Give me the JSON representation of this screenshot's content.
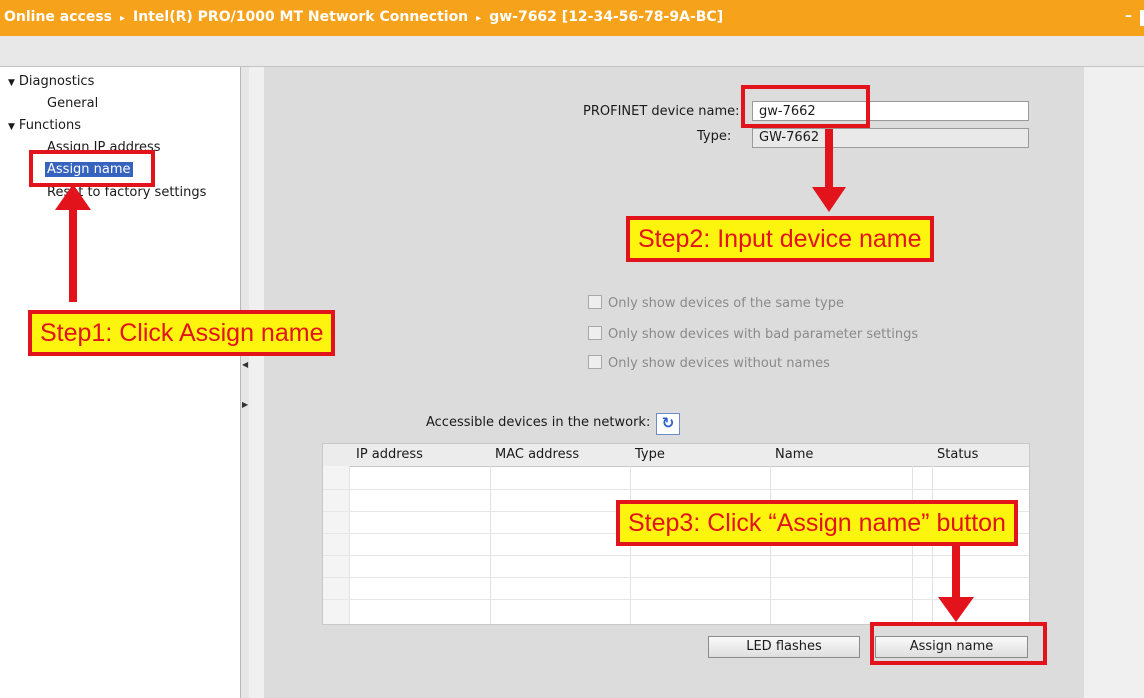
{
  "titlebar": {
    "crumb1": "Online access",
    "crumb2": "Intel(R) PRO/1000 MT Network Connection",
    "crumb3": "gw-7662 [12-34-56-78-9A-BC]",
    "separator": "▸",
    "minimize": "–"
  },
  "sidebar": {
    "diagnostics": "Diagnostics",
    "general": "General",
    "functions": "Functions",
    "assign_ip": "Assign IP address",
    "assign_name": "Assign name",
    "reset": "Reset to factory settings",
    "expanded_icon": "▼"
  },
  "form": {
    "device_name_label": "PROFINET device name:",
    "device_name_value": "gw-7662",
    "type_label": "Type:",
    "type_value": "GW-7662"
  },
  "filters": [
    {
      "label": "Only show devices of the same type",
      "checked": false
    },
    {
      "label": "Only show devices with bad parameter settings",
      "checked": false
    },
    {
      "label": "Only show devices without names",
      "checked": false
    }
  ],
  "network": {
    "label": "Accessible devices in the network:",
    "refresh_icon": "refresh-icon"
  },
  "table": {
    "columns": [
      "IP address",
      "MAC address",
      "Type",
      "Name",
      "Status"
    ],
    "rows": []
  },
  "buttons": {
    "led": "LED flashes",
    "assign": "Assign name"
  },
  "callouts": {
    "step1": "Step1: Click Assign name",
    "step2": "Step2: Input device name",
    "step3": "Step3: Click “Assign name” button"
  },
  "colors": {
    "titlebar": "#f7a21b",
    "annotation_red": "#e3131c",
    "callout_yellow": "#fef50e",
    "selection_blue": "#3563bd"
  }
}
